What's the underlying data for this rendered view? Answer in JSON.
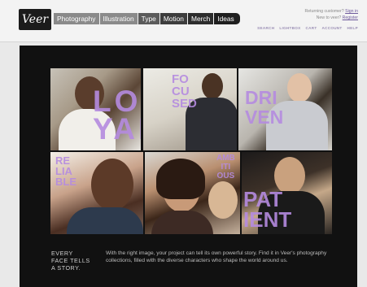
{
  "header": {
    "logo_text": "Veer",
    "tabs": [
      "Photography",
      "Illustration",
      "Type",
      "Motion",
      "Merch",
      "Ideas"
    ],
    "account": {
      "returning_prefix": "Returning customer?",
      "sign_in": "Sign in",
      "new_prefix": "New to veer?",
      "register": "Register"
    },
    "utility_links": [
      "SEARCH",
      "LIGHTBOX",
      "CART",
      "ACCOUNT",
      "HELP"
    ]
  },
  "hero": {
    "words": {
      "loyal": "LO\nYAL",
      "focused": "FO\nCU\nSED",
      "driven": "DRI\nVEN",
      "reliable": "RE\nLIA\nBLE",
      "ambitious": "AMB\nITI\nOUS",
      "patient": "PAT\nIENT"
    },
    "tagline": "EVERY\nFACE TELLS\nA STORY.",
    "blurb": "With the right image, your project can tell its own powerful story. Find it in Veer's photography collections, filled with the diverse characters who shape the world around us."
  },
  "colors": {
    "accent_purple": "#b58be0",
    "stage_background": "#111111"
  }
}
